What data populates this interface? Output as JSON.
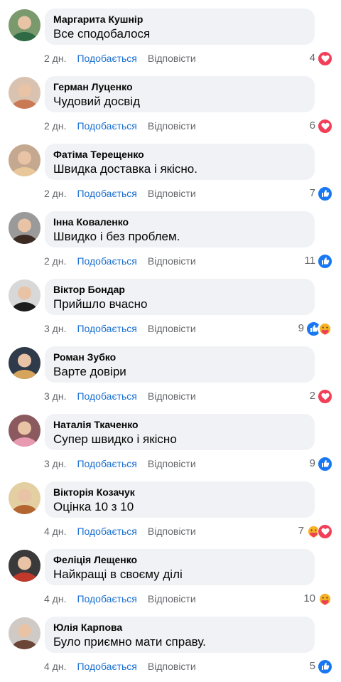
{
  "comments": [
    {
      "author": "Маргарита Кушнір",
      "text": "Все сподобалося",
      "time": "2 дн.",
      "like": "Подобається",
      "reply": "Відповісти",
      "count": "4",
      "reactions": [
        "love"
      ],
      "avatar_colors": [
        "#7a9a6e",
        "#2e6b45"
      ]
    },
    {
      "author": "Герман Луценко",
      "text": "Чудовий досвід",
      "time": "2 дн.",
      "like": "Подобається",
      "reply": "Відповісти",
      "count": "6",
      "reactions": [
        "love"
      ],
      "avatar_colors": [
        "#d9c3b0",
        "#c97a55"
      ]
    },
    {
      "author": "Фатіма Терещенко",
      "text": "Швидка доставка і якісно.",
      "time": "2 дн.",
      "like": "Подобається",
      "reply": "Відповісти",
      "count": "7",
      "reactions": [
        "like"
      ],
      "avatar_colors": [
        "#c4a88f",
        "#e8c89a"
      ]
    },
    {
      "author": "Інна Коваленко",
      "text": "Швидко і без проблем.",
      "time": "2 дн.",
      "like": "Подобається",
      "reply": "Відповісти",
      "count": "11",
      "reactions": [
        "like"
      ],
      "avatar_colors": [
        "#9a9a9a",
        "#3d2b23"
      ]
    },
    {
      "author": "Віктор Бондар",
      "text": "Прийшло вчасно",
      "time": "3 дн.",
      "like": "Подобається",
      "reply": "Відповісти",
      "count": "9",
      "reactions": [
        "like",
        "care"
      ],
      "avatar_colors": [
        "#d8d8d8",
        "#1c1c1c"
      ]
    },
    {
      "author": "Роман Зубко",
      "text": "Варте довіри",
      "time": "3 дн.",
      "like": "Подобається",
      "reply": "Відповісти",
      "count": "2",
      "reactions": [
        "love"
      ],
      "avatar_colors": [
        "#2f3a4a",
        "#d6a45a"
      ]
    },
    {
      "author": "Наталія Ткаченко",
      "text": "Супер швидко і якісно",
      "time": "3 дн.",
      "like": "Подобається",
      "reply": "Відповісти",
      "count": "9",
      "reactions": [
        "like"
      ],
      "avatar_colors": [
        "#8a5a5e",
        "#e79ab0"
      ]
    },
    {
      "author": "Вікторія Козачук",
      "text": "Оцінка 10 з 10",
      "time": "4 дн.",
      "like": "Подобається",
      "reply": "Відповісти",
      "count": "7",
      "reactions": [
        "care",
        "love"
      ],
      "avatar_colors": [
        "#e4cfa2",
        "#b5652f"
      ]
    },
    {
      "author": "Феліція Лещенко",
      "text": "Найкращі в своєму ділі",
      "time": "4 дн.",
      "like": "Подобається",
      "reply": "Відповісти",
      "count": "10",
      "reactions": [
        "care"
      ],
      "avatar_colors": [
        "#3a3a3a",
        "#c0392b"
      ]
    },
    {
      "author": "Юлія Карпова",
      "text": "Було приємно мати справу.",
      "time": "4 дн.",
      "like": "Подобається",
      "reply": "Відповісти",
      "count": "5",
      "reactions": [
        "like"
      ],
      "avatar_colors": [
        "#cfcac6",
        "#6b4636"
      ]
    }
  ],
  "colors": {
    "like": "#1877f2",
    "love": "#f33e58",
    "care": "#f7b125",
    "link": "#1a6fd1",
    "meta": "#65676b",
    "bubble": "#f0f2f5"
  }
}
